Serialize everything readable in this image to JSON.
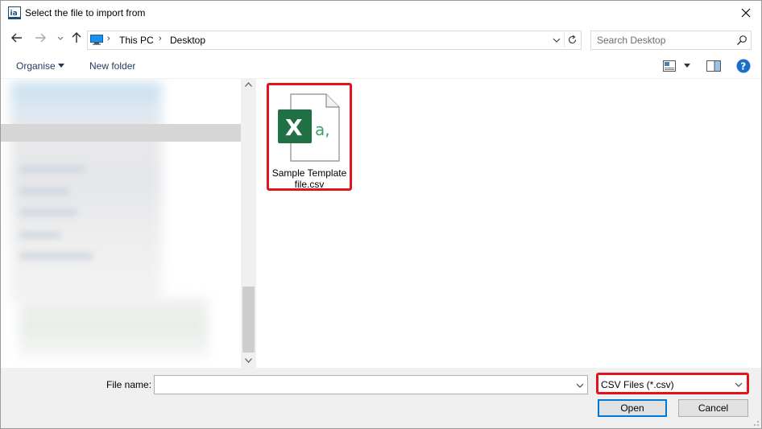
{
  "window": {
    "title": "Select the file to import from",
    "app_icon_text": "ia"
  },
  "address": {
    "crumbs": [
      "This PC",
      "Desktop"
    ],
    "search_placeholder": "Search Desktop"
  },
  "toolbar": {
    "organise_label": "Organise",
    "new_folder_label": "New folder"
  },
  "files": [
    {
      "name_line1": "Sample Template",
      "name_line2": "file.csv",
      "icon": "excel-csv-file-icon",
      "glyph_x": "X",
      "glyph_a": "a,",
      "highlighted": true
    }
  ],
  "bottom": {
    "file_name_label": "File name:",
    "file_name_value": "",
    "file_type_selected": "CSV Files (*.csv)",
    "open_label": "Open",
    "cancel_label": "Cancel"
  },
  "colors": {
    "highlight": "#e1141e",
    "excel_green": "#1f7145",
    "accent_blue": "#0078d7",
    "help_blue": "#1a6fc9"
  }
}
